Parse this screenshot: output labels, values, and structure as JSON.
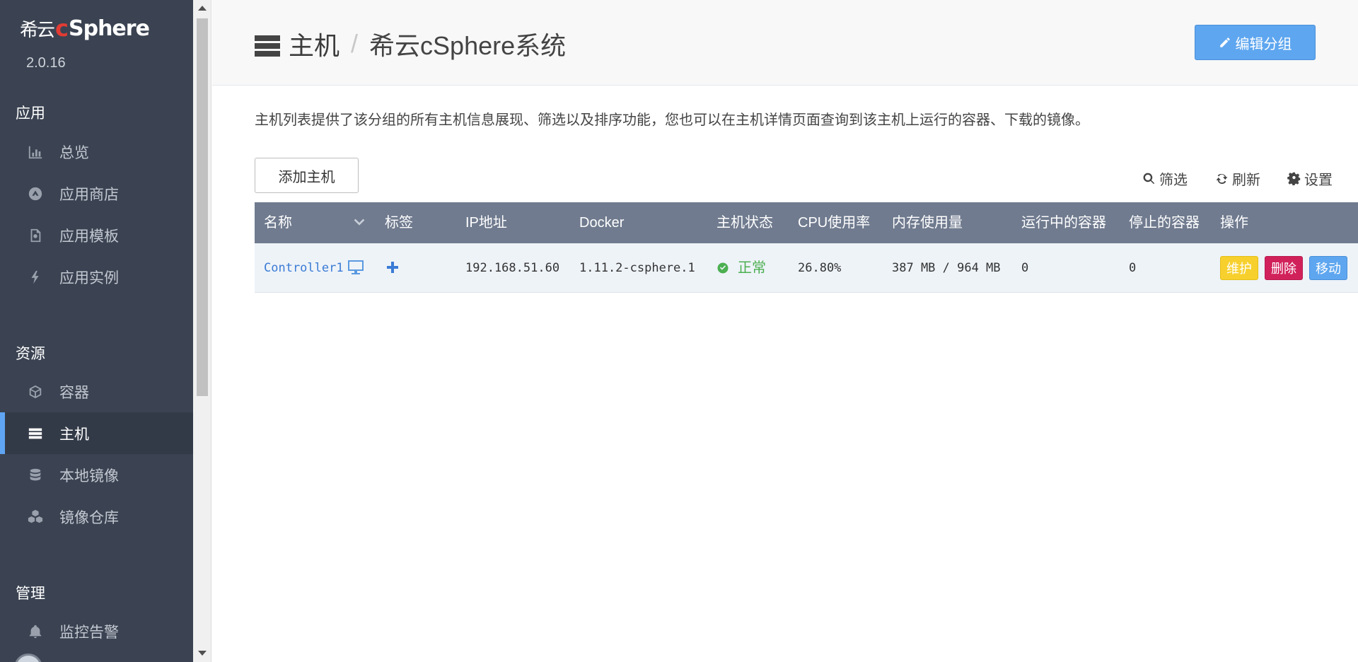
{
  "brand": {
    "cn": "希云",
    "c": "c",
    "rest": "Sphere",
    "version": "2.0.16"
  },
  "sidebar": {
    "sections": [
      {
        "title": "应用",
        "items": [
          {
            "label": "总览",
            "icon": "bar-chart-icon"
          },
          {
            "label": "应用商店",
            "icon": "store-icon"
          },
          {
            "label": "应用模板",
            "icon": "template-icon"
          },
          {
            "label": "应用实例",
            "icon": "bolt-icon"
          }
        ]
      },
      {
        "title": "资源",
        "items": [
          {
            "label": "容器",
            "icon": "cube-icon"
          },
          {
            "label": "主机",
            "icon": "server-icon",
            "active": true
          },
          {
            "label": "本地镜像",
            "icon": "database-icon"
          },
          {
            "label": "镜像仓库",
            "icon": "cubes-icon"
          }
        ]
      },
      {
        "title": "管理",
        "items": [
          {
            "label": "监控告警",
            "icon": "bell-icon"
          }
        ]
      }
    ]
  },
  "header": {
    "title": "主机",
    "separator": "/",
    "subtitle": "希云cSphere系统",
    "edit_button": "编辑分组"
  },
  "intro": "主机列表提供了该分组的所有主机信息展现、筛选以及排序功能，您也可以在主机详情页面查询到该主机上运行的容器、下载的镜像。",
  "toolbar": {
    "add_host": "添加主机",
    "filter": "筛选",
    "refresh": "刷新",
    "settings": "设置"
  },
  "table": {
    "columns": [
      "名称",
      "标签",
      "IP地址",
      "Docker",
      "主机状态",
      "CPU使用率",
      "内存使用量",
      "运行中的容器",
      "停止的容器",
      "操作"
    ],
    "rows": [
      {
        "name": "Controller1",
        "ip": "192.168.51.60",
        "docker": "1.11.2-csphere.1",
        "status": "正常",
        "cpu": "26.80%",
        "memory": "387 MB / 964 MB",
        "running": "0",
        "stopped": "0",
        "actions": [
          "维护",
          "删除",
          "移动"
        ]
      }
    ]
  },
  "colors": {
    "sidebar_bg": "#3b4352",
    "accent": "#5ea6ef",
    "table_header": "#707b8f",
    "status_ok": "#4caf50",
    "warn": "#f7d02d",
    "danger": "#d1215b"
  }
}
